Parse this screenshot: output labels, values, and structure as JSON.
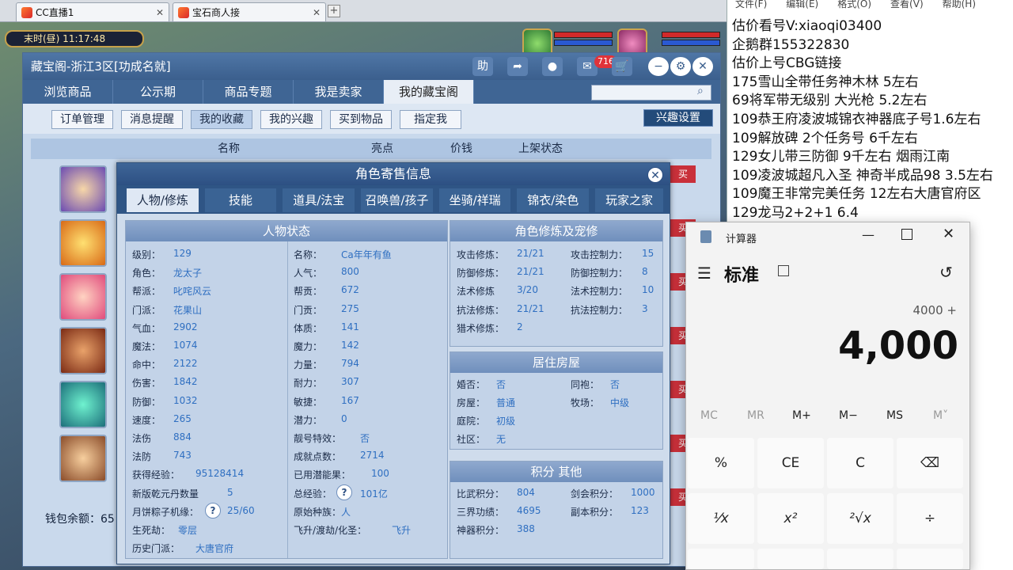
{
  "browser": {
    "tabs": [
      {
        "label": "CC直播1",
        "close": "✕"
      },
      {
        "label": "宝石商人接",
        "close": "✕"
      }
    ],
    "add_tab": "+"
  },
  "game_hud": {
    "clock": "末时(昼) 11:17:48"
  },
  "window": {
    "title": "藏宝阁-浙江3区[功成名就]",
    "title_buttons": [
      "助"
    ],
    "cart_count": "716",
    "nav": [
      "浏览商品",
      "公示期",
      "商品专题",
      "我是卖家",
      "我的藏宝阁"
    ],
    "sub_buttons": [
      "订单管理",
      "消息提醒",
      "我的收藏",
      "我的兴趣",
      "买到物品",
      "指定我"
    ],
    "interest_settings": "兴趣设置",
    "table_headers": [
      "名称",
      "亮点",
      "价钱",
      "上架状态"
    ],
    "wallet_label": "钱包余额：65",
    "side_buttons": [
      "买",
      "买",
      "买",
      "买",
      "买",
      "买",
      "买"
    ]
  },
  "dialog": {
    "title": "角色寄售信息",
    "tabs": [
      "人物/修炼",
      "技能",
      "道具/法宝",
      "召唤兽/孩子",
      "坐骑/祥瑞",
      "锦衣/染色",
      "玩家之家"
    ],
    "status_header": "人物状态",
    "status_left": [
      {
        "label": "级别：",
        "value": "129"
      },
      {
        "label": "角色：",
        "value": "龙太子"
      },
      {
        "label": "帮派：",
        "value": "叱咤风云"
      },
      {
        "label": "门派：",
        "value": "花果山"
      },
      {
        "label": "气血：",
        "value": "2902"
      },
      {
        "label": "魔法：",
        "value": "1074"
      },
      {
        "label": "命中：",
        "value": "2122"
      },
      {
        "label": "伤害：",
        "value": "1842"
      },
      {
        "label": "防御：",
        "value": "1032"
      },
      {
        "label": "速度：",
        "value": "265"
      },
      {
        "label": "法伤",
        "value": "884"
      },
      {
        "label": "法防",
        "value": "743"
      },
      {
        "label": "获得经验：",
        "value": "95128414"
      },
      {
        "label": "新版乾元丹数量",
        "value": "5"
      },
      {
        "label": "月饼粽子机缘：",
        "value": "25/60"
      },
      {
        "label": "生死劫：",
        "value": "零层"
      },
      {
        "label": "历史门派：",
        "value": "大唐官府"
      }
    ],
    "status_right": [
      {
        "label": "名称：",
        "value": "Ca年年有鱼"
      },
      {
        "label": "人气：",
        "value": "800"
      },
      {
        "label": "帮贡：",
        "value": "672"
      },
      {
        "label": "门贡：",
        "value": "275"
      },
      {
        "label": "体质：",
        "value": "141"
      },
      {
        "label": "魔力：",
        "value": "142"
      },
      {
        "label": "力量：",
        "value": "794"
      },
      {
        "label": "耐力：",
        "value": "307"
      },
      {
        "label": "敏捷：",
        "value": "167"
      },
      {
        "label": "潜力：",
        "value": "0"
      },
      {
        "label": "靓号特效：",
        "value": "否"
      },
      {
        "label": "成就点数：",
        "value": "2714"
      },
      {
        "label": "已用潜能果：",
        "value": "100"
      },
      {
        "label": "总经验：",
        "value": "101亿"
      },
      {
        "label": "原始种族：",
        "value": "人"
      },
      {
        "label": "飞升/渡劫/化圣：",
        "value": "飞升"
      }
    ],
    "cultivation_header": "角色修炼及宠修",
    "cultivation_left": [
      {
        "label": "攻击修炼：",
        "value": "21/21"
      },
      {
        "label": "防御修炼：",
        "value": "21/21"
      },
      {
        "label": "法术修炼",
        "value": "3/20"
      },
      {
        "label": "抗法修炼：",
        "value": "21/21"
      },
      {
        "label": "猎术修炼：",
        "value": "2"
      }
    ],
    "cultivation_right": [
      {
        "label": "攻击控制力：",
        "value": "15"
      },
      {
        "label": "防御控制力：",
        "value": "8"
      },
      {
        "label": "法术控制力：",
        "value": "10"
      },
      {
        "label": "抗法控制力：",
        "value": "3"
      }
    ],
    "house_header": "居住房屋",
    "house": [
      {
        "label": "婚否：",
        "value": "否"
      },
      {
        "label": "同袍：",
        "value": "否"
      },
      {
        "label": "房屋：",
        "value": "普通"
      },
      {
        "label": "牧场：",
        "value": "中级"
      },
      {
        "label": "庭院：",
        "value": "初级"
      },
      {
        "label": "社区：",
        "value": "无"
      }
    ],
    "points_header": "积分 其他",
    "points": [
      {
        "label": "比武积分：",
        "value": "804"
      },
      {
        "label": "剑会积分：",
        "value": "1000"
      },
      {
        "label": "三界功绩：",
        "value": "4695"
      },
      {
        "label": "副本积分：",
        "value": "123"
      },
      {
        "label": "神器积分：",
        "value": "388"
      }
    ],
    "question_mark": "?"
  },
  "notepad": {
    "menu": [
      "文件(F)",
      "编辑(E)",
      "格式(O)",
      "查看(V)",
      "帮助(H)"
    ],
    "lines": [
      "估价看号V:xiaoqi03400",
      "企鹅群155322830",
      "估价上号CBG链接",
      "175雪山全带任务神木林 5左右",
      "69将军带无级别 大光枪 5.2左右",
      "109恭王府凌波城锦衣神器底子号1.6左右",
      "109解放碑 2个任务号 6千左右",
      "129女儿带三防御 9千左右 烟雨江南",
      "109凌波城超凡入圣 神奇半成品98 3.5左右",
      "109魔王非常完美任务 12左右大唐官府区",
      "129龙马2+2+1  6.4"
    ]
  },
  "calculator": {
    "app_title": "计算器",
    "mode": "标准",
    "expression": "4000 +",
    "display": "4,000",
    "memory": [
      "MC",
      "MR",
      "M+",
      "M−",
      "MS",
      "M˅"
    ],
    "keys_row1": [
      "%",
      "CE",
      "C",
      "⌫"
    ],
    "keys_row2": [
      "¹⁄x",
      "x²",
      "²√x",
      "÷"
    ]
  }
}
